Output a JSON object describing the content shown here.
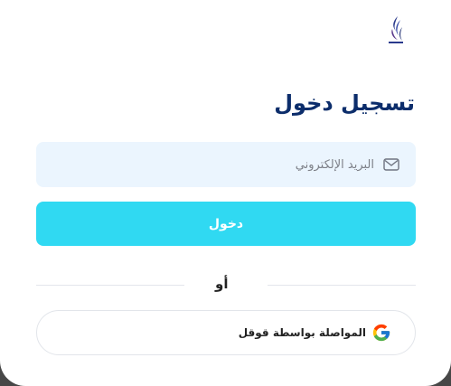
{
  "form": {
    "title": "تسجيل دخول",
    "email_placeholder": "البريد الإلكتروني",
    "email_value": "",
    "login_label": "دخول",
    "divider_text": "أو",
    "google_label": "المواصلة بواسطة قوقل"
  },
  "icons": {
    "logo": "organization-logo",
    "email": "mail-icon",
    "google": "google-icon"
  },
  "colors": {
    "title": "#0c2d6b",
    "accent_button": "#30d9f2",
    "input_background": "#ebf5fe",
    "backdrop": "#474747"
  }
}
